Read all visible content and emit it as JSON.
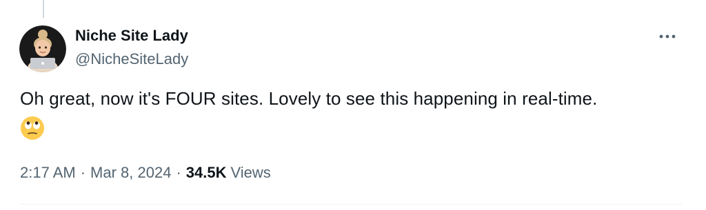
{
  "tweet": {
    "author": {
      "display_name": "Niche Site Lady",
      "handle": "@NicheSiteLady",
      "avatar_icon": "memoji-avatar-with-laptop"
    },
    "more_icon": "more-horizontal-icon",
    "text": "Oh great, now it's FOUR sites. Lovely to see this happening in real-time.",
    "emoji": "face-with-rolling-eyes",
    "time": "2:17 AM",
    "date": "Mar 8, 2024",
    "separator": "·",
    "views_count": "34.5K",
    "views_label": "Views"
  },
  "colors": {
    "text_primary": "#0f1419",
    "text_secondary": "#536471",
    "divider": "#eff3f4",
    "thread_line": "#cfd9de"
  }
}
